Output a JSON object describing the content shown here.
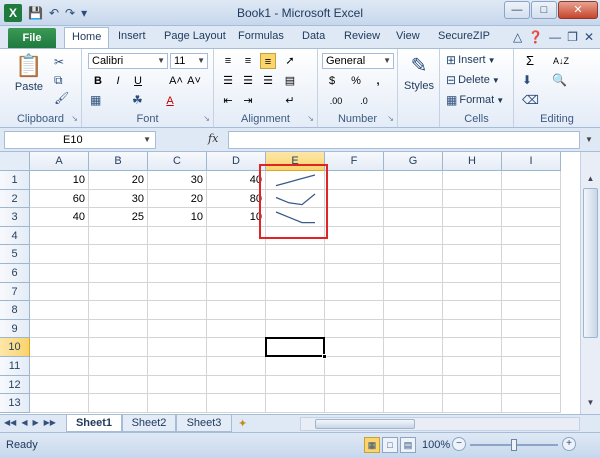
{
  "window": {
    "title": "Book1 - Microsoft Excel",
    "app_icon": "X",
    "qat": [
      "save-icon",
      "undo-icon",
      "redo-icon",
      "customize-icon"
    ],
    "buttons": [
      "—",
      "□",
      "✕"
    ]
  },
  "tabs": {
    "file": "File",
    "items": [
      "Home",
      "Insert",
      "Page Layout",
      "Formulas",
      "Data",
      "Review",
      "View",
      "SecureZIP"
    ],
    "active": "Home"
  },
  "ribbon": {
    "clipboard": {
      "paste": "Paste",
      "label": "Clipboard"
    },
    "font": {
      "name": "Calibri",
      "size": "11",
      "bold": "B",
      "italic": "I",
      "underline": "U",
      "grow": "A˄",
      "shrink": "A˅",
      "font_color_letter": "A",
      "label": "Font"
    },
    "alignment": {
      "label": "Alignment"
    },
    "number": {
      "format": "General",
      "currency": "$",
      "percent": "%",
      "comma": ",",
      "inc": ".00",
      "dec": ".0",
      "label": "Number"
    },
    "styles": {
      "label": "Styles"
    },
    "cells": {
      "insert": "Insert",
      "delete": "Delete",
      "format": "Format",
      "label": "Cells"
    },
    "editing": {
      "sum": "Σ",
      "sort": "A↓Z",
      "label": "Editing"
    }
  },
  "formula_bar": {
    "name_box": "E10",
    "fx": "fx",
    "formula": ""
  },
  "sheet": {
    "columns": [
      "A",
      "B",
      "C",
      "D",
      "E",
      "F",
      "G",
      "H",
      "I"
    ],
    "rows": [
      "1",
      "2",
      "3",
      "4",
      "5",
      "6",
      "7",
      "8",
      "9",
      "10",
      "11",
      "12",
      "13"
    ],
    "cells": [
      [
        "10",
        "20",
        "30",
        "40"
      ],
      [
        "60",
        "30",
        "20",
        "80"
      ],
      [
        "40",
        "25",
        "10",
        "10"
      ]
    ],
    "active_cell": "E10",
    "sparklines": [
      [
        10,
        20,
        30,
        40
      ],
      [
        60,
        30,
        20,
        80
      ],
      [
        40,
        25,
        10,
        10
      ]
    ],
    "sparkline_color": "#3a5a8c",
    "highlight_color": "#e02424"
  },
  "sheet_tabs": {
    "tabs": [
      "Sheet1",
      "Sheet2",
      "Sheet3"
    ],
    "active": "Sheet1"
  },
  "status": {
    "text": "Ready",
    "zoom": "100%",
    "zoom_fraction": 0.5
  }
}
